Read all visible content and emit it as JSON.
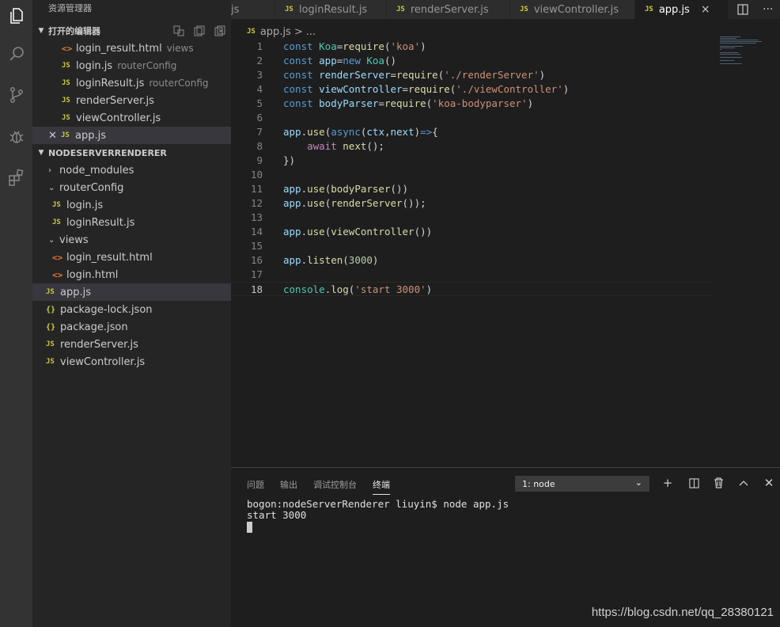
{
  "sidebar": {
    "title": "资源管理器",
    "open_editors": {
      "header": "打开的编辑器",
      "items": [
        {
          "icon": "<>",
          "name": "login_result.html",
          "desc": "views"
        },
        {
          "icon": "JS",
          "name": "login.js",
          "desc": "routerConfig"
        },
        {
          "icon": "JS",
          "name": "loginResult.js",
          "desc": "routerConfig"
        },
        {
          "icon": "JS",
          "name": "renderServer.js",
          "desc": ""
        },
        {
          "icon": "JS",
          "name": "viewController.js",
          "desc": ""
        },
        {
          "icon": "JS",
          "name": "app.js",
          "desc": ""
        }
      ]
    },
    "project": {
      "header": "NODESERVERRENDERER",
      "items": [
        {
          "kind": "folder-closed",
          "name": "node_modules"
        },
        {
          "kind": "folder-open",
          "name": "routerConfig"
        },
        {
          "kind": "js",
          "icon": "JS",
          "name": "login.js"
        },
        {
          "kind": "js",
          "icon": "JS",
          "name": "loginResult.js"
        },
        {
          "kind": "folder-open",
          "name": "views"
        },
        {
          "kind": "html",
          "icon": "<>",
          "name": "login_result.html"
        },
        {
          "kind": "html",
          "icon": "<>",
          "name": "login.html"
        },
        {
          "kind": "js",
          "icon": "JS",
          "name": "app.js"
        },
        {
          "kind": "json",
          "icon": "{}",
          "name": "package-lock.json"
        },
        {
          "kind": "json",
          "icon": "{}",
          "name": "package.json"
        },
        {
          "kind": "js",
          "icon": "JS",
          "name": "renderServer.js"
        },
        {
          "kind": "js",
          "icon": "JS",
          "name": "viewController.js"
        }
      ]
    }
  },
  "tabs": [
    {
      "icon": "",
      "label": "js"
    },
    {
      "icon": "JS",
      "label": "loginResult.js"
    },
    {
      "icon": "JS",
      "label": "renderServer.js"
    },
    {
      "icon": "JS",
      "label": "viewController.js"
    },
    {
      "icon": "JS",
      "label": "app.js",
      "close": "×"
    }
  ],
  "tab_tools": {
    "split": "split-editor-icon",
    "more": "···"
  },
  "breadcrumb": {
    "icon": "JS",
    "file": "app.js",
    "sep": ">",
    "more": "..."
  },
  "editor": {
    "line_numbers": [
      "1",
      "2",
      "3",
      "4",
      "5",
      "6",
      "7",
      "8",
      "9",
      "10",
      "11",
      "12",
      "13",
      "14",
      "15",
      "16",
      "17",
      "18"
    ],
    "lines": [
      [
        [
          "kw",
          "const "
        ],
        [
          "cl",
          "Koa"
        ],
        [
          "pl",
          "="
        ],
        [
          "fn",
          "require"
        ],
        [
          "pl",
          "("
        ],
        [
          "st",
          "'koa'"
        ],
        [
          "pl",
          ")"
        ]
      ],
      [
        [
          "kw",
          "const "
        ],
        [
          "vr",
          "app"
        ],
        [
          "pl",
          "="
        ],
        [
          "kw",
          "new "
        ],
        [
          "cl",
          "Koa"
        ],
        [
          "pl",
          "()"
        ]
      ],
      [
        [
          "kw",
          "const "
        ],
        [
          "vr",
          "renderServer"
        ],
        [
          "pl",
          "="
        ],
        [
          "fn",
          "require"
        ],
        [
          "pl",
          "("
        ],
        [
          "st",
          "'./renderServer'"
        ],
        [
          "pl",
          ")"
        ]
      ],
      [
        [
          "kw",
          "const "
        ],
        [
          "vr",
          "viewController"
        ],
        [
          "pl",
          "="
        ],
        [
          "fn",
          "require"
        ],
        [
          "pl",
          "("
        ],
        [
          "st",
          "'./viewController'"
        ],
        [
          "pl",
          ")"
        ]
      ],
      [
        [
          "kw",
          "const "
        ],
        [
          "vr",
          "bodyParser"
        ],
        [
          "pl",
          "="
        ],
        [
          "fn",
          "require"
        ],
        [
          "pl",
          "("
        ],
        [
          "st",
          "'koa-bodyparser'"
        ],
        [
          "pl",
          ")"
        ]
      ],
      [],
      [
        [
          "vr",
          "app"
        ],
        [
          "pl",
          "."
        ],
        [
          "fn",
          "use"
        ],
        [
          "pl",
          "("
        ],
        [
          "kw",
          "async"
        ],
        [
          "pl",
          "("
        ],
        [
          "vr",
          "ctx"
        ],
        [
          "pl",
          ","
        ],
        [
          "vr",
          "next"
        ],
        [
          "pl",
          ")"
        ],
        [
          "kw",
          "=>"
        ],
        [
          "pl",
          "{"
        ]
      ],
      [
        [
          "pl",
          "    "
        ],
        [
          "kw2",
          "await "
        ],
        [
          "fn",
          "next"
        ],
        [
          "pl",
          "();"
        ]
      ],
      [
        [
          "pl",
          "})"
        ]
      ],
      [],
      [
        [
          "vr",
          "app"
        ],
        [
          "pl",
          "."
        ],
        [
          "fn",
          "use"
        ],
        [
          "pl",
          "("
        ],
        [
          "fn",
          "bodyParser"
        ],
        [
          "pl",
          "())"
        ]
      ],
      [
        [
          "vr",
          "app"
        ],
        [
          "pl",
          "."
        ],
        [
          "fn",
          "use"
        ],
        [
          "pl",
          "("
        ],
        [
          "fn",
          "renderServer"
        ],
        [
          "pl",
          "());"
        ]
      ],
      [],
      [
        [
          "vr",
          "app"
        ],
        [
          "pl",
          "."
        ],
        [
          "fn",
          "use"
        ],
        [
          "pl",
          "("
        ],
        [
          "fn",
          "viewController"
        ],
        [
          "pl",
          "())"
        ]
      ],
      [],
      [
        [
          "vr",
          "app"
        ],
        [
          "pl",
          "."
        ],
        [
          "fn",
          "listen"
        ],
        [
          "pl",
          "("
        ],
        [
          "nm",
          "3000"
        ],
        [
          "pl",
          ")"
        ]
      ],
      [],
      [
        [
          "cl",
          "console"
        ],
        [
          "pl",
          "."
        ],
        [
          "fn",
          "log"
        ],
        [
          "pl",
          "("
        ],
        [
          "st",
          "'start 3000'"
        ],
        [
          "pl",
          ")"
        ]
      ]
    ]
  },
  "panel": {
    "tabs": [
      "问题",
      "输出",
      "调试控制台",
      "终端"
    ],
    "active_tab": "终端",
    "terminal_select": "1: node",
    "terminal_lines": [
      "bogon:nodeServerRenderer liuyin$ node app.js",
      "start 3000"
    ]
  },
  "watermark": "https://blog.csdn.net/qq_28380121",
  "colors": {
    "activity_bar": "#333333",
    "sidebar": "#252526",
    "editor_bg": "#1e1e1e",
    "js_icon": "#cbcb41",
    "html_icon": "#e37933"
  }
}
